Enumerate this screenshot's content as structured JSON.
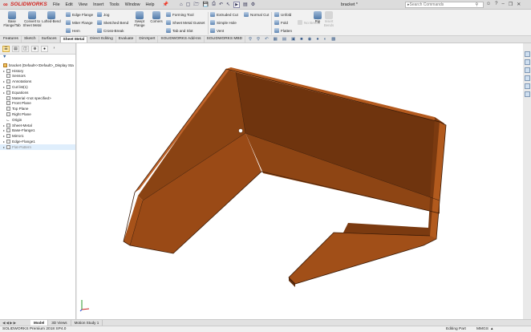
{
  "titlebar": {
    "logo_text": "SOLIDWORKS",
    "menus": [
      "File",
      "Edit",
      "View",
      "Insert",
      "Tools",
      "Window",
      "Help"
    ],
    "document_title": "bracket *",
    "search_placeholder": "Search Commands"
  },
  "ribbon": {
    "big_buttons": [
      {
        "label": "Base Flange/Tab"
      },
      {
        "label": "Convert to Sheet Metal"
      },
      {
        "label": "Lofted-Bend"
      },
      {
        "label": "Swept Flange"
      },
      {
        "label": "Corners"
      },
      {
        "label": "Rip"
      },
      {
        "label": "Insert Bends"
      }
    ],
    "small_buttons": [
      {
        "label": "Edge Flange",
        "enabled": true
      },
      {
        "label": "Miter Flange",
        "enabled": true
      },
      {
        "label": "Hem",
        "enabled": true
      },
      {
        "label": "Jog",
        "enabled": true
      },
      {
        "label": "Sketched Bend",
        "enabled": true
      },
      {
        "label": "Cross-Break",
        "enabled": true
      },
      {
        "label": "Forming Tool",
        "enabled": true
      },
      {
        "label": "Sheet Metal Gusset",
        "enabled": true
      },
      {
        "label": "Tab and Slot",
        "enabled": true
      },
      {
        "label": "Extruded Cut",
        "enabled": true
      },
      {
        "label": "Simple Hole",
        "enabled": true
      },
      {
        "label": "Vent",
        "enabled": true
      },
      {
        "label": "Normal Cut",
        "enabled": true
      },
      {
        "label": "Unfold",
        "enabled": true
      },
      {
        "label": "Fold",
        "enabled": true
      },
      {
        "label": "Flatten",
        "enabled": true
      },
      {
        "label": "No Bends",
        "enabled": false
      }
    ]
  },
  "command_tabs": [
    {
      "label": "Features",
      "active": false
    },
    {
      "label": "Sketch",
      "active": false
    },
    {
      "label": "Surfaces",
      "active": false
    },
    {
      "label": "Sheet Metal",
      "active": true
    },
    {
      "label": "Direct Editing",
      "active": false
    },
    {
      "label": "Evaluate",
      "active": false
    },
    {
      "label": "DimXpert",
      "active": false
    },
    {
      "label": "SOLIDWORKS Add-Ins",
      "active": false
    },
    {
      "label": "SOLIDWORKS MBD",
      "active": false
    }
  ],
  "feature_tree": {
    "root_label": "bracket (Default<<Default>_Display Sta",
    "items": [
      {
        "label": "History",
        "expandable": true
      },
      {
        "label": "Sensors",
        "expandable": false
      },
      {
        "label": "Annotations",
        "expandable": true
      },
      {
        "label": "Cut list(1)",
        "expandable": true
      },
      {
        "label": "Equations",
        "expandable": true
      },
      {
        "label": "Material <not specified>",
        "expandable": false
      },
      {
        "label": "Front Plane",
        "expandable": false
      },
      {
        "label": "Top Plane",
        "expandable": false
      },
      {
        "label": "Right Plane",
        "expandable": false
      },
      {
        "label": "Origin",
        "expandable": false
      },
      {
        "label": "Sheet-Metal",
        "expandable": true
      },
      {
        "label": "Base-Flange1",
        "expandable": true
      },
      {
        "label": "Mirror1",
        "expandable": true
      },
      {
        "label": "Edge-Flange1",
        "expandable": true
      },
      {
        "label": "Flat-Pattern",
        "expandable": true,
        "gray": true
      }
    ]
  },
  "bottom_tabs": [
    {
      "label": "Model",
      "active": true
    },
    {
      "label": "3D Views",
      "active": false
    },
    {
      "label": "Motion Study 1",
      "active": false
    }
  ],
  "status": {
    "product": "SOLIDWORKS Premium 2018 SP4.0",
    "mode": "Editing Part",
    "units": "MMGS"
  },
  "colors": {
    "part_face_dark": "#7a3a10",
    "part_face_light": "#b85a1c",
    "logo_red": "#d2231e"
  }
}
